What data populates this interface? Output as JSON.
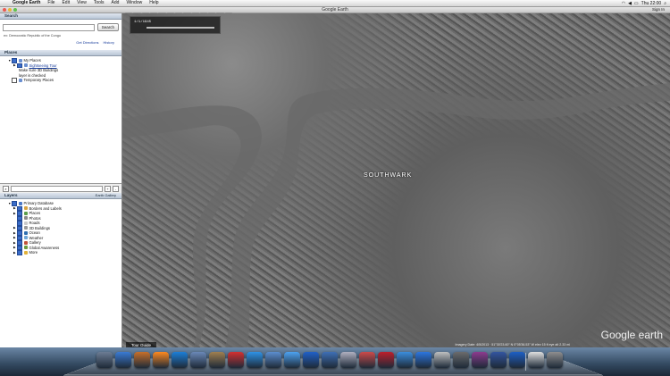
{
  "menubar": {
    "apple": "",
    "items": [
      "Google Earth",
      "File",
      "Edit",
      "View",
      "Tools",
      "Add",
      "Window",
      "Help"
    ],
    "clock": "Thu 22:00"
  },
  "window": {
    "title": "Google Earth",
    "signin": "Sign In"
  },
  "search": {
    "header": "Search",
    "button": "Search",
    "hint": "ex: Democratic Republic of the Congo",
    "links": [
      "Get Directions",
      "History"
    ]
  },
  "places": {
    "header": "Places",
    "items": [
      {
        "label": "My Places",
        "level": 1,
        "checked": true,
        "expand": "▼"
      },
      {
        "label": "Sightseeing Tour",
        "level": 2,
        "checked": true,
        "expand": "▶",
        "link": true
      },
      {
        "label": "Make sure 3D Buildings",
        "level": 3,
        "checked": false,
        "expand": ""
      },
      {
        "label": "layer is checked",
        "level": 3,
        "checked": false,
        "expand": ""
      },
      {
        "label": "Temporary Places",
        "level": 1,
        "checked": false,
        "expand": ""
      }
    ]
  },
  "layers": {
    "header": "Layers",
    "gallery": "Earth Gallery",
    "items": [
      {
        "label": "Primary Database",
        "level": 1,
        "expand": "▼",
        "color": "#4a78c8"
      },
      {
        "label": "Borders and Labels",
        "level": 2,
        "expand": "▶",
        "color": "#d9a441"
      },
      {
        "label": "Places",
        "level": 2,
        "expand": "▶",
        "color": "#5b9d4a"
      },
      {
        "label": "Photos",
        "level": 2,
        "expand": "",
        "color": "#8a8a8a"
      },
      {
        "label": "Roads",
        "level": 2,
        "expand": "",
        "color": "#c9c9c9"
      },
      {
        "label": "3D Buildings",
        "level": 2,
        "expand": "▶",
        "color": "#9a9a9a"
      },
      {
        "label": "Ocean",
        "level": 2,
        "expand": "▶",
        "color": "#2f6fb0"
      },
      {
        "label": "Weather",
        "level": 2,
        "expand": "▶",
        "color": "#6fa6d8"
      },
      {
        "label": "Gallery",
        "level": 2,
        "expand": "▶",
        "color": "#c2533a"
      },
      {
        "label": "Global Awareness",
        "level": 2,
        "expand": "▶",
        "color": "#6c9b3b"
      },
      {
        "label": "More",
        "level": 2,
        "expand": "▶",
        "color": "#e2b23a"
      }
    ]
  },
  "map": {
    "district": "SOUTHWARK",
    "tour_button": "Tour Guide",
    "status": "Imagery Date: 4/5/2013 · 51°30'23.60\" N 0°05'36.53\" W elev 15 ft eye alt 2.33 mi",
    "logo": "Google earth",
    "timestamp": "1/1/1945"
  },
  "dock": {
    "colors": [
      "#6d7d95",
      "#3a7bd5",
      "#c8702a",
      "#ff8a1f",
      "#1c7fd8",
      "#6b89b8",
      "#a08050",
      "#d43030",
      "#2e93e6",
      "#5c8fd0",
      "#4da3f2",
      "#2060c8",
      "#3e6fb5",
      "#b0b0c0",
      "#cc4a4a",
      "#bd1f2b",
      "#3b8ede",
      "#2c76e0",
      "#c0c0c0",
      "#6c6c6c",
      "#8d3b8f",
      "#3355a0",
      "#1d5fc5",
      "#e0e0e0",
      "#8f8f8f"
    ]
  }
}
